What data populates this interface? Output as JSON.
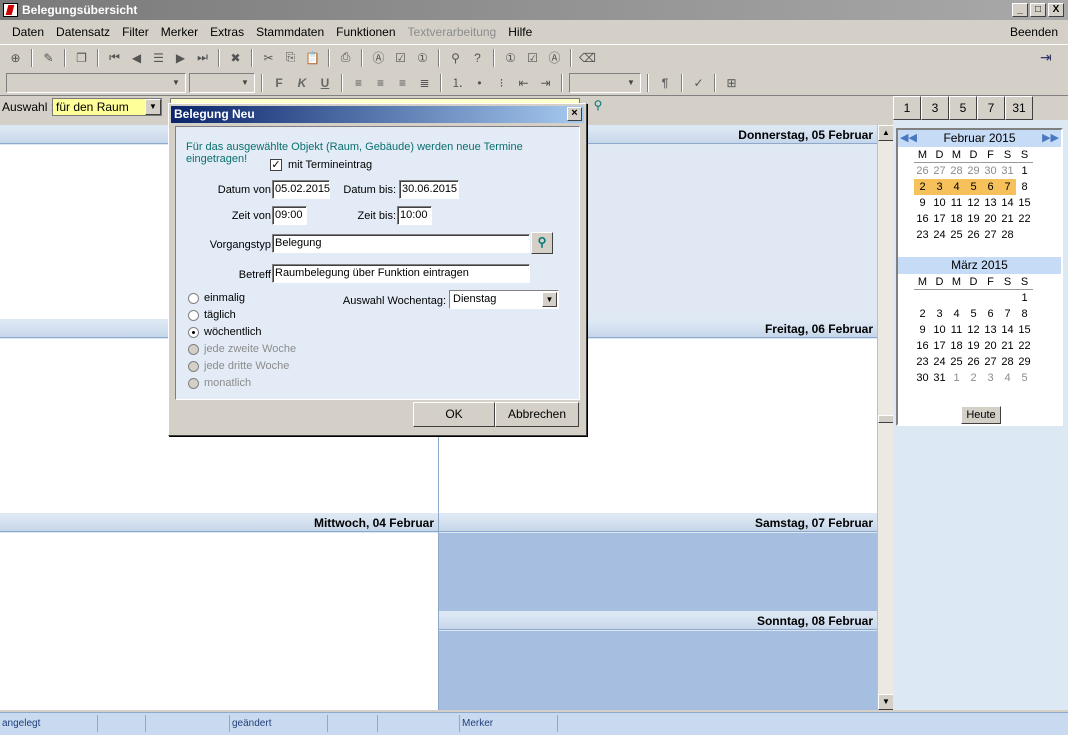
{
  "window": {
    "title": "Belegungsübersicht",
    "min": "_",
    "max": "□",
    "close": "X"
  },
  "menu": {
    "items": [
      {
        "label": "Daten",
        "disabled": false
      },
      {
        "label": "Datensatz",
        "disabled": false
      },
      {
        "label": "Filter",
        "disabled": false
      },
      {
        "label": "Merker",
        "disabled": false
      },
      {
        "label": "Extras",
        "disabled": false
      },
      {
        "label": "Stammdaten",
        "disabled": false
      },
      {
        "label": "Funktionen",
        "disabled": false
      },
      {
        "label": "Textverarbeitung",
        "disabled": true
      },
      {
        "label": "Hilfe",
        "disabled": false
      }
    ],
    "end_label": "Beenden"
  },
  "format_toolbar": {
    "bold": "F",
    "italic": "K",
    "underline": "U",
    "paragraph": "¶"
  },
  "selection": {
    "label": "Auswahl :",
    "value": "für den Raum"
  },
  "range_buttons": [
    "1",
    "3",
    "5",
    "7",
    "31"
  ],
  "days": {
    "thu": "Donnerstag, 05 Februar",
    "fri": "Freitag, 06 Februar",
    "wed": "Mittwoch, 04 Februar",
    "sat": "Samstag, 07 Februar",
    "sun": "Sonntag, 08 Februar"
  },
  "minical": {
    "weekday_headers": [
      "M",
      "D",
      "M",
      "D",
      "F",
      "S",
      "S"
    ],
    "feb": {
      "title": "Februar 2015",
      "days": [
        "26",
        "27",
        "28",
        "29",
        "30",
        "31",
        "1",
        "2",
        "3",
        "4",
        "5",
        "6",
        "7",
        "8",
        "9",
        "10",
        "11",
        "12",
        "13",
        "14",
        "15",
        "16",
        "17",
        "18",
        "19",
        "20",
        "21",
        "22",
        "23",
        "24",
        "25",
        "26",
        "27",
        "28"
      ],
      "other_month_count": 6,
      "selected_days": [
        "2",
        "3",
        "4",
        "5",
        "6",
        "7",
        "8"
      ]
    },
    "mar": {
      "title": "März 2015",
      "days": [
        "",
        "",
        "",
        "",
        "",
        "",
        "1",
        "2",
        "3",
        "4",
        "5",
        "6",
        "7",
        "8",
        "9",
        "10",
        "11",
        "12",
        "13",
        "14",
        "15",
        "16",
        "17",
        "18",
        "19",
        "20",
        "21",
        "22",
        "23",
        "24",
        "25",
        "26",
        "27",
        "28",
        "29",
        "30",
        "31",
        "1",
        "2",
        "3",
        "4",
        "5"
      ],
      "trailing_other_from": 37
    },
    "today_label": "Heute"
  },
  "statusbar": {
    "angelegt": "angelegt",
    "geaendert": "geändert",
    "merker": "Merker"
  },
  "dialog": {
    "title": "Belegung Neu",
    "info": "Für das ausgewählte Objekt (Raum, Gebäude) werden neue Termine eingetragen!",
    "mit_termineintrag_label": "mit Termineintrag",
    "mit_termineintrag_checked": true,
    "datum_von_label": "Datum von:",
    "datum_von": "05.02.2015",
    "datum_bis_label": "Datum bis:",
    "datum_bis": "30.06.2015",
    "zeit_von_label": "Zeit von:",
    "zeit_von": "09:00",
    "zeit_bis_label": "Zeit bis:",
    "zeit_bis": "10:00",
    "vorgangstyp_label": "Vorgangstyp:",
    "vorgangstyp": "Belegung",
    "betreff_label": "Betreff:",
    "betreff": "Raumbelegung über Funktion eintragen",
    "wochentag_label": "Auswahl Wochentag:",
    "wochentag": "Dienstag",
    "recurrence": [
      {
        "label": "einmalig",
        "checked": false,
        "disabled": false
      },
      {
        "label": "täglich",
        "checked": false,
        "disabled": false
      },
      {
        "label": "wöchentlich",
        "checked": true,
        "disabled": false
      },
      {
        "label": "jede zweite Woche",
        "checked": false,
        "disabled": true
      },
      {
        "label": "jede dritte Woche",
        "checked": false,
        "disabled": true
      },
      {
        "label": "monatlich",
        "checked": false,
        "disabled": true
      }
    ],
    "ok_label": "OK",
    "cancel_label": "Abbrechen"
  }
}
